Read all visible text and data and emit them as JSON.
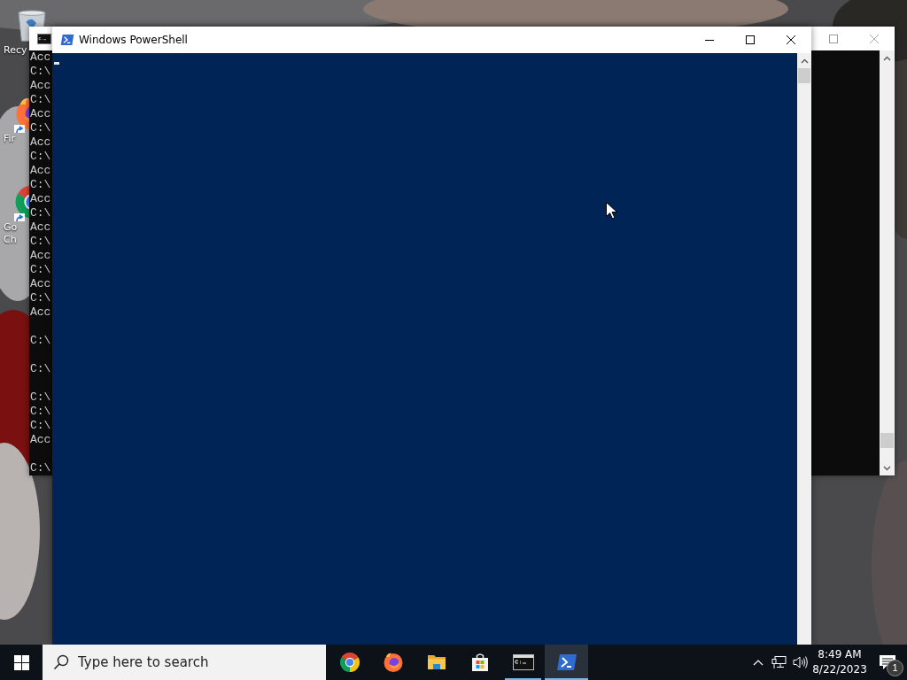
{
  "desktop": {
    "icons": [
      {
        "kind": "recycle-bin",
        "shortcut": false,
        "label_lines": [
          "Recy"
        ]
      },
      {
        "kind": "firefox",
        "shortcut": true,
        "label_lines": [
          "Fir"
        ]
      },
      {
        "kind": "chrome",
        "shortcut": true,
        "label_lines": [
          "Go",
          "Ch"
        ]
      }
    ]
  },
  "background_window": {
    "lines": [
      {
        "kind": "text",
        "text": "Acc"
      },
      {
        "kind": "text",
        "text": "C:\\"
      },
      {
        "kind": "text",
        "text": "Acc"
      },
      {
        "kind": "text",
        "text": "C:\\"
      },
      {
        "kind": "text",
        "text": "Acc"
      },
      {
        "kind": "text",
        "text": "C:\\"
      },
      {
        "kind": "text",
        "text": "Acc"
      },
      {
        "kind": "text",
        "text": "C:\\"
      },
      {
        "kind": "text",
        "text": "Acc"
      },
      {
        "kind": "text",
        "text": "C:\\"
      },
      {
        "kind": "text",
        "text": "Acc"
      },
      {
        "kind": "text",
        "text": "C:\\"
      },
      {
        "kind": "text",
        "text": "Acc"
      },
      {
        "kind": "text",
        "text": "C:\\"
      },
      {
        "kind": "text",
        "text": "Acc"
      },
      {
        "kind": "text",
        "text": "C:\\"
      },
      {
        "kind": "text",
        "text": "Acc"
      },
      {
        "kind": "text",
        "text": "C:\\"
      },
      {
        "kind": "text",
        "text": "Acc"
      },
      {
        "kind": "blank"
      },
      {
        "kind": "text",
        "text": "C:\\"
      },
      {
        "kind": "blank"
      },
      {
        "kind": "text",
        "text": "C:\\"
      },
      {
        "kind": "blank"
      },
      {
        "kind": "text",
        "text": "C:\\"
      },
      {
        "kind": "text",
        "text": "C:\\"
      },
      {
        "kind": "text",
        "text": "C:\\"
      },
      {
        "kind": "text",
        "text": "Acc"
      },
      {
        "kind": "blank"
      },
      {
        "kind": "text",
        "text": "C:\\"
      }
    ]
  },
  "window": {
    "title": "Windows PowerShell"
  },
  "taskbar": {
    "search": {
      "placeholder": "Type here to search"
    },
    "apps": [
      {
        "kind": "chrome",
        "running": false,
        "selected": false
      },
      {
        "kind": "firefox",
        "running": false,
        "selected": false
      },
      {
        "kind": "folder",
        "running": false,
        "selected": false
      },
      {
        "kind": "store",
        "running": false,
        "selected": false
      },
      {
        "kind": "console",
        "running": true,
        "selected": false
      },
      {
        "kind": "powershell",
        "running": true,
        "selected": true
      }
    ],
    "clock": {
      "time": "8:49 AM",
      "date": "8/22/2023"
    },
    "notifications": {
      "count": "1"
    }
  }
}
